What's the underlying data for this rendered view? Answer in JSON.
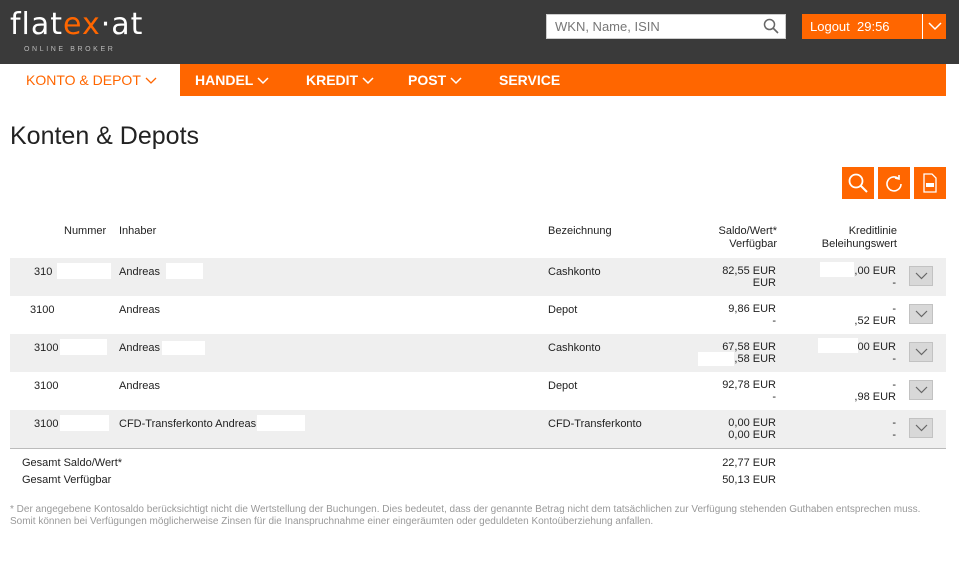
{
  "header": {
    "logo_text_a": "flat",
    "logo_text_b": "ex",
    "logo_text_c": "·at",
    "logo_sub": "ONLINE BROKER",
    "search_placeholder": "WKN, Name, ISIN",
    "logout_label": "Logout",
    "logout_timer": "29:56"
  },
  "nav": {
    "items": [
      {
        "label": "KONTO & DEPOT",
        "active": true
      },
      {
        "label": "HANDEL"
      },
      {
        "label": "KREDIT"
      },
      {
        "label": "POST"
      },
      {
        "label": "SERVICE"
      }
    ]
  },
  "page": {
    "title": "Konten & Depots"
  },
  "table": {
    "headers": {
      "nummer": "Nummer",
      "inhaber": "Inhaber",
      "bezeichnung": "Bezeichnung",
      "saldo_line1": "Saldo/Wert*",
      "saldo_line2": "Verfügbar",
      "kredit_line1": "Kreditlinie",
      "kredit_line2": "Beleihungswert"
    },
    "rows": [
      {
        "nummer": "310",
        "inhaber": "Andreas",
        "bezeichnung": "Cashkonto",
        "saldo": "82,55 EUR",
        "verfuegbar": "EUR",
        "kredit": ",00 EUR",
        "beleihung": "-"
      },
      {
        "nummer": "3100",
        "inhaber": "Andreas",
        "bezeichnung": "Depot",
        "saldo": "9,86 EUR",
        "verfuegbar": "-",
        "kredit": "-",
        "beleihung": ",52 EUR"
      },
      {
        "nummer": "3100",
        "inhaber": "Andreas",
        "bezeichnung": "Cashkonto",
        "saldo": "67,58 EUR",
        "verfuegbar": "7,58 EUR",
        "kredit": "00 EUR",
        "beleihung": "-"
      },
      {
        "nummer": "3100",
        "inhaber": "Andreas",
        "bezeichnung": "Depot",
        "saldo": "92,78 EUR",
        "verfuegbar": "-",
        "kredit": "-",
        "beleihung": ",98 EUR"
      },
      {
        "nummer": "3100",
        "inhaber": "CFD-Transferkonto Andreas",
        "bezeichnung": "CFD-Transferkonto",
        "saldo": "0,00 EUR",
        "verfuegbar": "0,00 EUR",
        "kredit": "-",
        "beleihung": "-"
      }
    ]
  },
  "totals": {
    "saldo_label": "Gesamt Saldo/Wert*",
    "saldo_value": "22,77 EUR",
    "verfuegbar_label": "Gesamt Verfügbar",
    "verfuegbar_value": "50,13 EUR"
  },
  "footnote": "* Der angegebene Kontosaldo berücksichtigt nicht die Wertstellung der Buchungen. Dies bedeutet, dass der genannte Betrag nicht dem tatsächlichen zur Verfügung stehenden Guthaben entsprechen muss. Somit können bei Verfügungen möglicherweise Zinsen für die Inanspruchnahme einer eingeräumten oder geduldeten Kontoüberziehung anfallen.",
  "colors": {
    "brand": "#ff6600",
    "header_bg": "#3a3a3a",
    "row_alt": "#efefef"
  },
  "icons": [
    "search-icon",
    "chevron-down-icon",
    "refresh-icon",
    "xls-export-icon"
  ]
}
